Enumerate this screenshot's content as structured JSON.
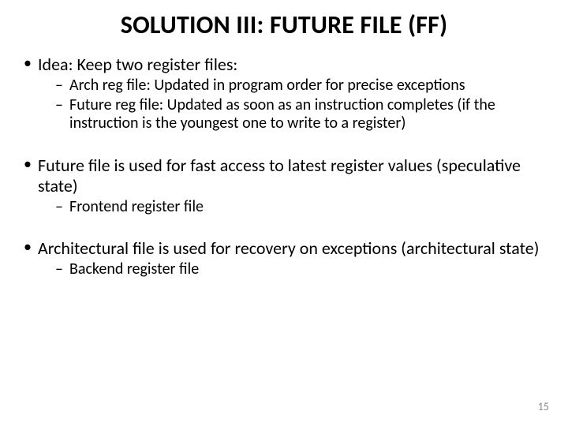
{
  "title": "SOLUTION III: FUTURE FILE (FF)",
  "bullets": [
    {
      "text": "Idea: Keep two register files:",
      "sub": [
        "Arch reg file: Updated in program order for precise exceptions",
        "Future reg file: Updated as soon as an instruction completes (if the instruction is the youngest one to write to a register)"
      ]
    },
    {
      "text": "Future file is used for fast access to latest register values (speculative state)",
      "sub": [
        "Frontend register file"
      ]
    },
    {
      "text": "Architectural file is used for recovery on exceptions (architectural state)",
      "sub": [
        "Backend register file"
      ]
    }
  ],
  "page_number": "15"
}
